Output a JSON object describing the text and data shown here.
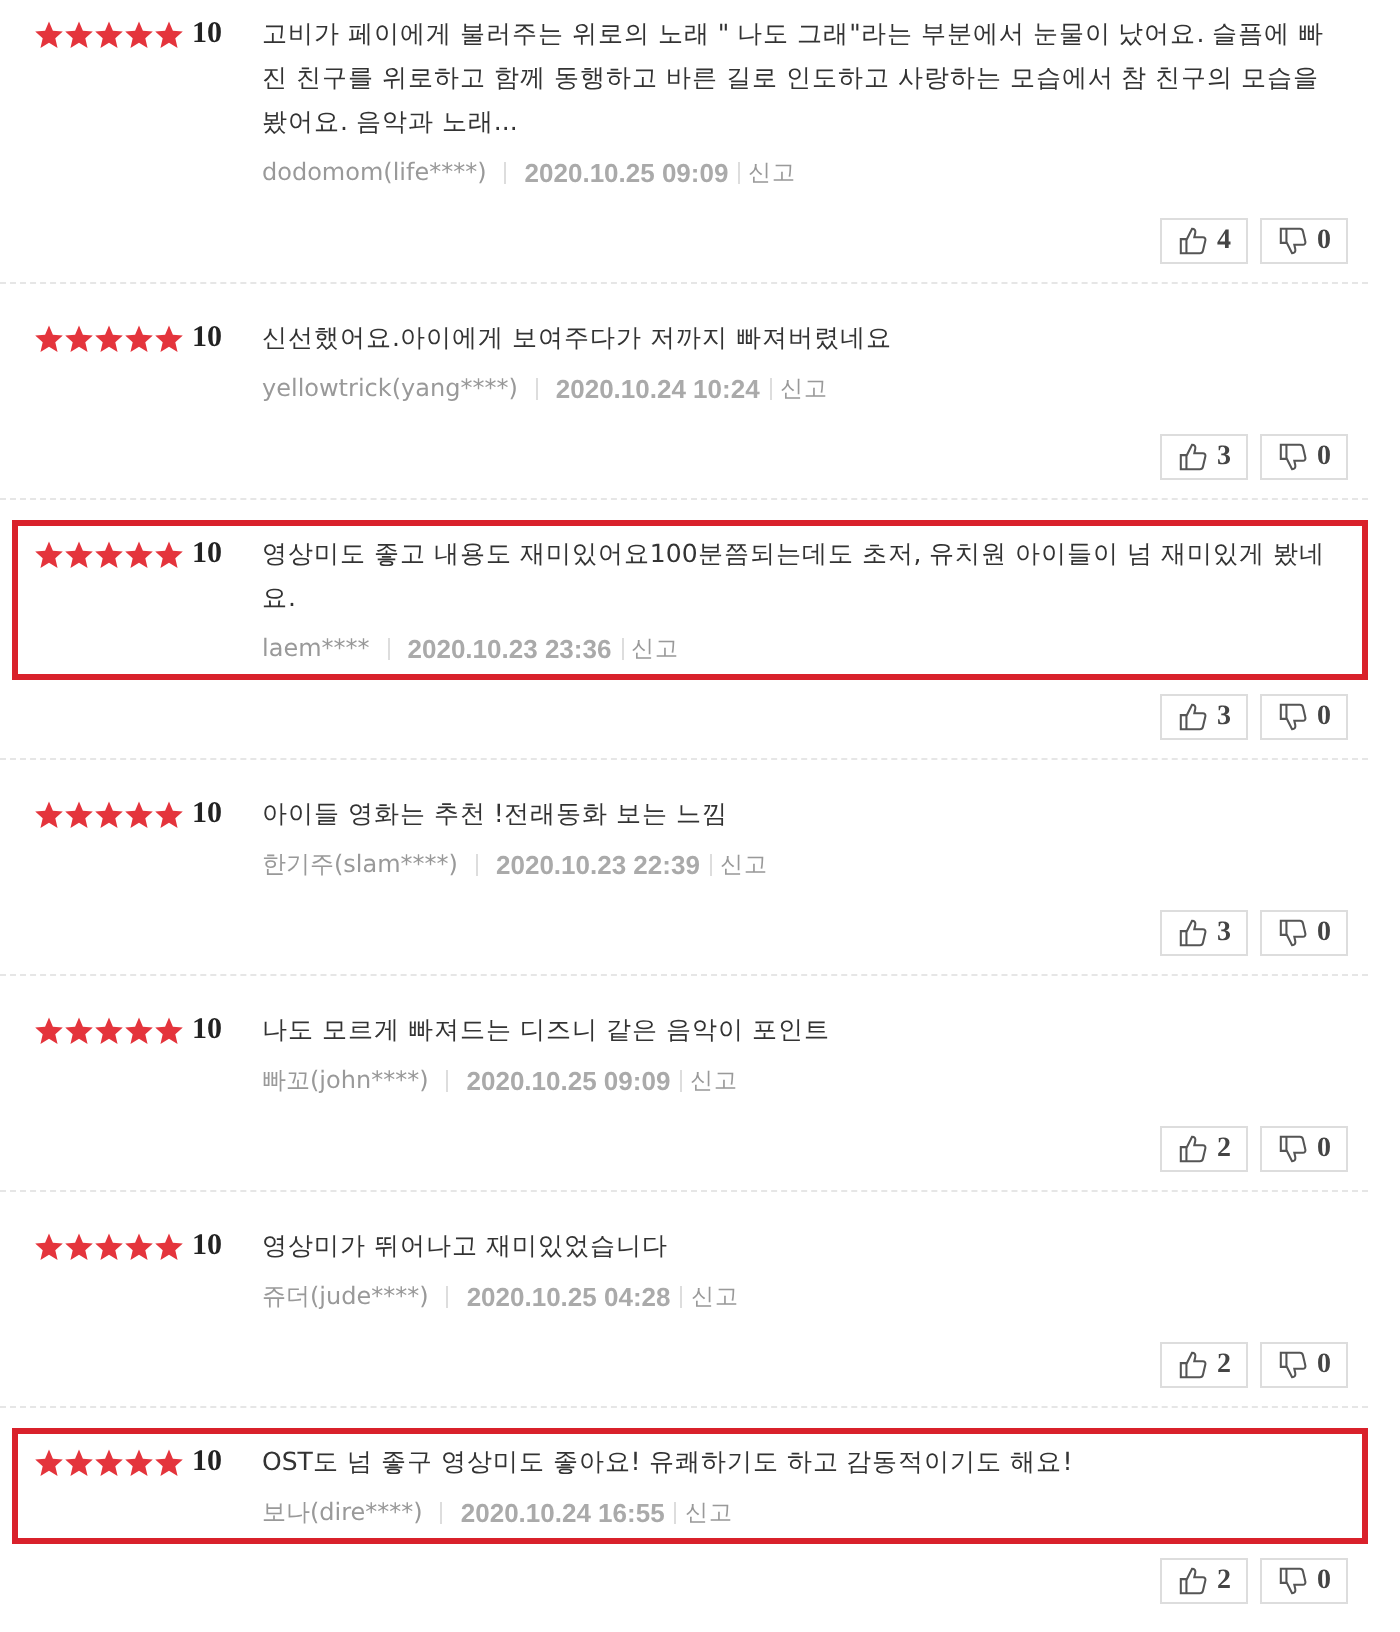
{
  "reviews": [
    {
      "stars": 5,
      "score": "10",
      "text": "고비가 페이에게 불러주는 위로의 노래 \" 나도 그래\"라는 부분에서 눈물이 났어요. 슬픔에 빠진 친구를 위로하고 함께 동행하고 바른 길로 인도하고 사랑하는 모습에서 참 친구의 모습을 봤어요. 음악과 노래...",
      "author": "dodomom(life****)",
      "date": "2020.10.25 09:09",
      "report": "신고",
      "likes": "4",
      "dislikes": "0",
      "highlighted": false
    },
    {
      "stars": 5,
      "score": "10",
      "text": "신선했어요.아이에게 보여주다가 저까지 빠져버렸네요",
      "author": "yellowtrick(yang****)",
      "date": "2020.10.24 10:24",
      "report": "신고",
      "likes": "3",
      "dislikes": "0",
      "highlighted": false
    },
    {
      "stars": 5,
      "score": "10",
      "text": "영상미도 좋고 내용도 재미있어요100분쯤되는데도 초저, 유치원 아이들이 넘 재미있게 봤네요.",
      "author": "laem****",
      "date": "2020.10.23 23:36",
      "report": "신고",
      "likes": "3",
      "dislikes": "0",
      "highlighted": true
    },
    {
      "stars": 5,
      "score": "10",
      "text": "아이들 영화는 추천 !전래동화 보는 느낌",
      "author": "한기주(slam****)",
      "date": "2020.10.23 22:39",
      "report": "신고",
      "likes": "3",
      "dislikes": "0",
      "highlighted": false
    },
    {
      "stars": 5,
      "score": "10",
      "text": "나도 모르게 빠져드는 디즈니 같은 음악이 포인트",
      "author": "빠꼬(john****)",
      "date": "2020.10.25 09:09",
      "report": "신고",
      "likes": "2",
      "dislikes": "0",
      "highlighted": false
    },
    {
      "stars": 5,
      "score": "10",
      "text": "영상미가 뛰어나고 재미있었습니다",
      "author": "쥬더(jude****)",
      "date": "2020.10.25 04:28",
      "report": "신고",
      "likes": "2",
      "dislikes": "0",
      "highlighted": false
    },
    {
      "stars": 5,
      "score": "10",
      "text": "OST도 넘 좋구 영상미도 좋아요! 유쾌하기도 하고 감동적이기도 해요!",
      "author": "보나(dire****)",
      "date": "2020.10.24 16:55",
      "report": "신고",
      "likes": "2",
      "dislikes": "0",
      "highlighted": true
    }
  ]
}
